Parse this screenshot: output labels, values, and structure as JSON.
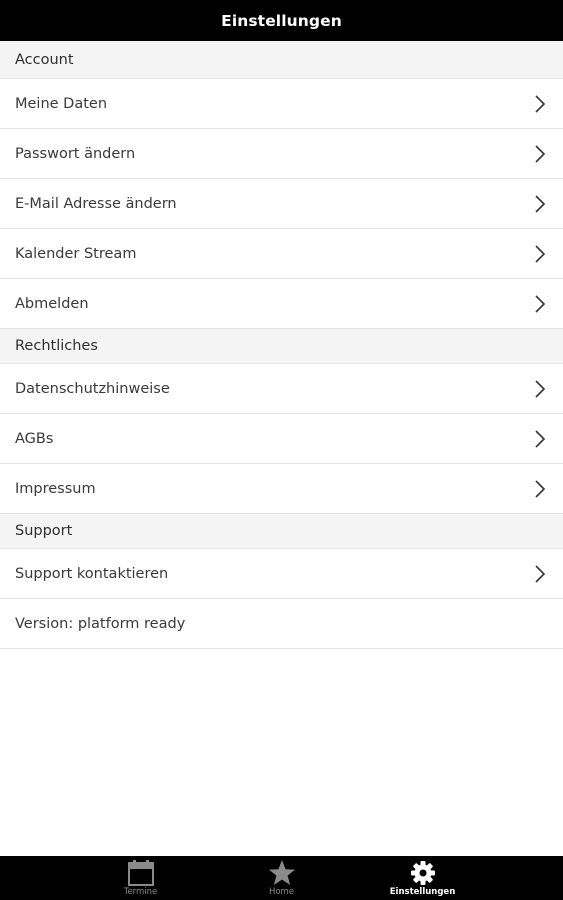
{
  "header": {
    "title": "Einstellungen"
  },
  "sections": [
    {
      "title": "Account",
      "items": [
        {
          "label": "Meine Daten",
          "icon": "chevron-right-icon"
        },
        {
          "label": "Passwort ändern",
          "icon": "chevron-right-icon"
        },
        {
          "label": "E-Mail Adresse ändern",
          "icon": "chevron-right-icon"
        },
        {
          "label": "Kalender Stream",
          "icon": "chevron-right-icon"
        },
        {
          "label": "Abmelden",
          "icon": "chevron-right-icon"
        }
      ]
    },
    {
      "title": "Rechtliches",
      "items": [
        {
          "label": "Datenschutzhinweise",
          "icon": "chevron-right-icon"
        },
        {
          "label": "AGBs",
          "icon": "chevron-right-icon"
        },
        {
          "label": "Impressum",
          "icon": "chevron-right-icon"
        }
      ]
    },
    {
      "title": "Support",
      "items": [
        {
          "label": "Support kontaktieren",
          "icon": "chevron-right-icon"
        }
      ],
      "version_text": "Version: platform ready"
    }
  ],
  "tabbar": {
    "active": "Einstellungen",
    "tabs": [
      {
        "label": "Termine",
        "icon": "calendar-icon"
      },
      {
        "label": "Home",
        "icon": "star-icon"
      },
      {
        "label": "Einstellungen",
        "icon": "gear-icon"
      }
    ]
  },
  "colors": {
    "header_bg": "#000000",
    "section_bg": "#f4f4f4",
    "tab_active": "#ffffff",
    "tab_inactive": "#8a8a8a"
  }
}
